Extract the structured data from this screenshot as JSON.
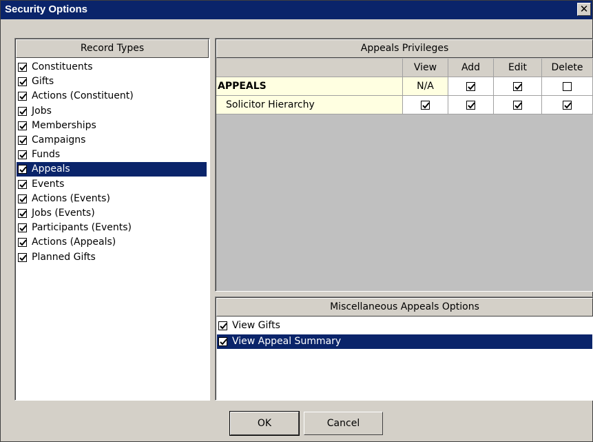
{
  "window": {
    "title": "Security Options"
  },
  "record_types": {
    "header": "Record Types",
    "items": [
      {
        "label": "Constituents",
        "checked": true
      },
      {
        "label": "Gifts",
        "checked": true
      },
      {
        "label": "Actions (Constituent)",
        "checked": true
      },
      {
        "label": "Jobs",
        "checked": true
      },
      {
        "label": "Memberships",
        "checked": true
      },
      {
        "label": "Campaigns",
        "checked": true
      },
      {
        "label": "Funds",
        "checked": true
      },
      {
        "label": "Appeals",
        "checked": true,
        "selected": true
      },
      {
        "label": "Events",
        "checked": true
      },
      {
        "label": "Actions (Events)",
        "checked": true
      },
      {
        "label": "Jobs (Events)",
        "checked": true
      },
      {
        "label": "Participants (Events)",
        "checked": true
      },
      {
        "label": "Actions (Appeals)",
        "checked": true
      },
      {
        "label": "Planned Gifts",
        "checked": true
      }
    ]
  },
  "privileges": {
    "header": "Appeals Privileges",
    "columns": [
      "View",
      "Add",
      "Edit",
      "Delete"
    ],
    "rows": [
      {
        "name": "APPEALS",
        "view": "N/A",
        "add": true,
        "edit": true,
        "delete": false
      },
      {
        "name": "Solicitor Hierarchy",
        "view": true,
        "add": true,
        "edit": true,
        "delete": true
      }
    ]
  },
  "misc_options": {
    "header": "Miscellaneous Appeals Options",
    "items": [
      {
        "label": "View Gifts",
        "checked": true
      },
      {
        "label": "View Appeal Summary",
        "checked": true,
        "selected": true
      }
    ]
  },
  "buttons": {
    "ok": "OK",
    "cancel": "Cancel"
  },
  "colors": {
    "title_bar": "#0a246a",
    "selection": "#0a246a",
    "dialog_face": "#d4d0c8",
    "row_highlight": "#ffffe1"
  }
}
